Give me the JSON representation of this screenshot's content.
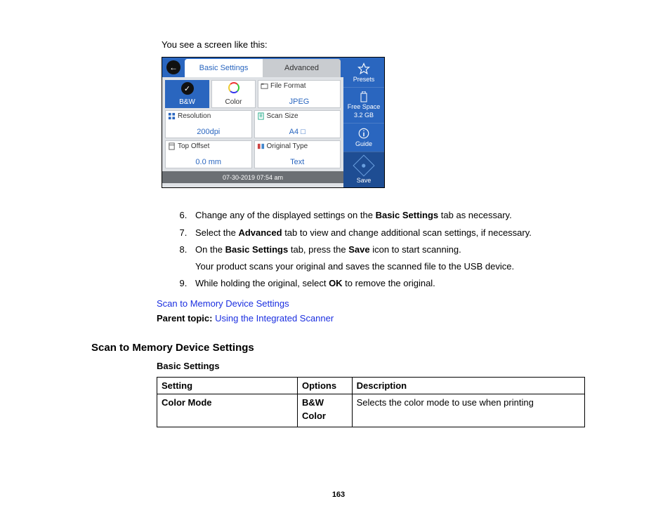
{
  "intro_text": "You see a screen like this:",
  "device": {
    "tabs": {
      "basic": "Basic Settings",
      "advanced": "Advanced"
    },
    "color_mode": {
      "bw": "B&W",
      "color": "Color"
    },
    "file_format": {
      "label": "File Format",
      "value": "JPEG"
    },
    "resolution": {
      "label": "Resolution",
      "value": "200dpi"
    },
    "scan_size": {
      "label": "Scan Size",
      "value": "A4"
    },
    "top_offset": {
      "label": "Top Offset",
      "value": "0.0 mm"
    },
    "original_type": {
      "label": "Original Type",
      "value": "Text"
    },
    "status_time": "07-30-2019 07:54 am",
    "right": {
      "presets": "Presets",
      "free_space_label": "Free Space",
      "free_space_value": "3.2 GB",
      "guide": "Guide",
      "save": "Save"
    }
  },
  "steps": [
    {
      "n": 6,
      "pre": "Change any of the displayed settings on the ",
      "b1": "Basic Settings",
      "post": " tab as necessary."
    },
    {
      "n": 7,
      "pre": "Select the ",
      "b1": "Advanced",
      "post": " tab to view and change additional scan settings, if necessary."
    },
    {
      "n": 8,
      "pre": "On the ",
      "b1": "Basic Settings",
      "mid": " tab, press the ",
      "b2": "Save",
      "post": " icon to start scanning.",
      "sub": "Your product scans your original and saves the scanned file to the USB device."
    },
    {
      "n": 9,
      "pre": "While holding the original, select ",
      "b1": "OK",
      "post": " to remove the original."
    }
  ],
  "link_scan_settings": "Scan to Memory Device Settings",
  "parent_topic_label": "Parent topic:",
  "parent_topic_link": "Using the Integrated Scanner",
  "section_heading": "Scan to Memory Device Settings",
  "table_subhead": "Basic Settings",
  "table": {
    "head": {
      "setting": "Setting",
      "options": "Options",
      "description": "Description"
    },
    "row1": {
      "setting": "Color Mode",
      "opt1": "B&W",
      "opt2": "Color",
      "desc": "Selects the color mode to use when printing"
    }
  },
  "page_number": "163"
}
